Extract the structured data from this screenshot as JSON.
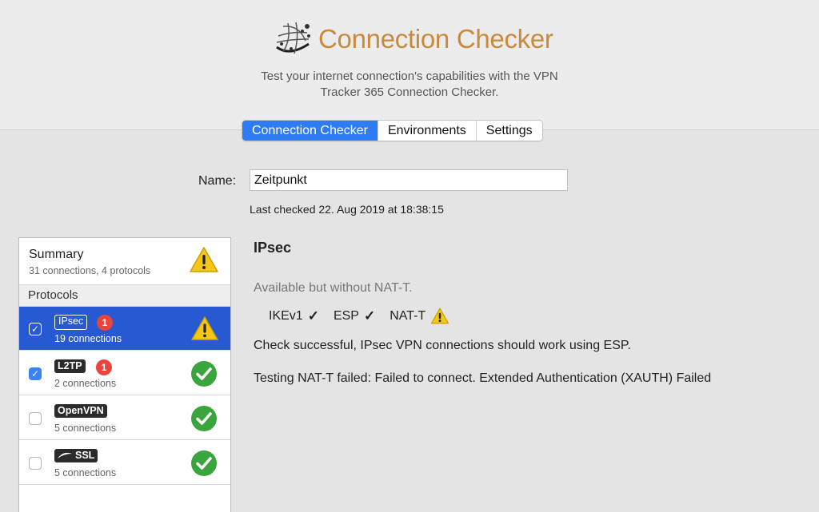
{
  "header": {
    "title": "Connection Checker",
    "subtitle_line1": "Test your internet connection's capabilities with the VPN",
    "subtitle_line2": "Tracker 365 Connection Checker.",
    "logo_icon": "globe-logo-icon",
    "title_color": "#c98a3c"
  },
  "tabs": [
    {
      "label": "Connection Checker",
      "active": true
    },
    {
      "label": "Environments",
      "active": false
    },
    {
      "label": "Settings",
      "active": false
    }
  ],
  "form": {
    "name_label": "Name:",
    "name_value": "Zeitpunkt",
    "last_checked": "Last checked 22. Aug 2019 at 18:38:15"
  },
  "sidebar": {
    "summary_title": "Summary",
    "summary_sub": "31 connections, 4 protocols",
    "summary_status": "warning-icon",
    "protocols_header": "Protocols",
    "items": [
      {
        "tag": "IPsec",
        "badge": "1",
        "connections": "19 connections",
        "checked": true,
        "selected": true,
        "status": "warning-icon"
      },
      {
        "tag": "L2TP",
        "badge": "1",
        "connections": "2 connections",
        "checked": true,
        "selected": false,
        "status": "checkmark-circle-icon"
      },
      {
        "tag": "OpenVPN",
        "badge": "",
        "connections": "5 connections",
        "checked": false,
        "selected": false,
        "status": "checkmark-circle-icon"
      },
      {
        "tag": "SSL",
        "badge": "",
        "connections": "5 connections",
        "checked": false,
        "selected": false,
        "status": "checkmark-circle-icon"
      }
    ]
  },
  "detail": {
    "title": "IPsec",
    "availability": "Available but without NAT-T.",
    "checks": [
      {
        "label": "IKEv1",
        "ok": true
      },
      {
        "label": "ESP",
        "ok": true
      },
      {
        "label": "NAT-T",
        "ok": false
      }
    ],
    "message1": "Check successful, IPsec VPN connections should work using ESP.",
    "message2": "Testing NAT-T failed: Failed to connect. Extended Authentication (XAUTH) Failed"
  },
  "colors": {
    "accent": "#2d7cf6",
    "selection": "#2759d3",
    "badge": "#e8453c",
    "success": "#3aa53c",
    "warning": "#f5c816"
  }
}
